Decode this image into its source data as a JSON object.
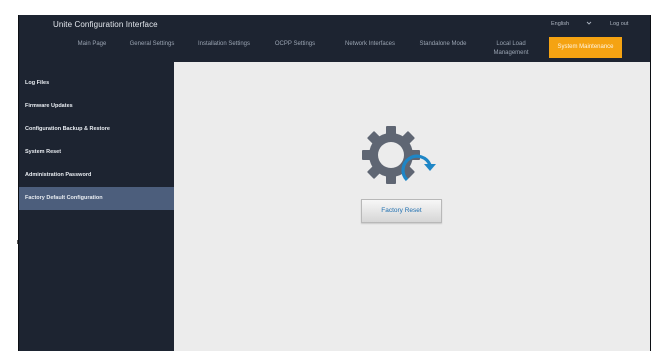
{
  "header": {
    "title": "Unite Configuration Interface",
    "language": "English",
    "logout": "Log out"
  },
  "nav": {
    "items": [
      {
        "label": "Main Page"
      },
      {
        "label": "General Settings"
      },
      {
        "label": "Installation Settings"
      },
      {
        "label": "OCPP Settings"
      },
      {
        "label": "Network Interfaces"
      },
      {
        "label": "Standalone Mode"
      },
      {
        "label": "Local Load Management"
      },
      {
        "label": "System Maintenance",
        "active": true
      }
    ]
  },
  "sidebar": {
    "items": [
      {
        "label": "Log Files"
      },
      {
        "label": "Firmware Updates"
      },
      {
        "label": "Configuration Backup & Restore"
      },
      {
        "label": "System Reset"
      },
      {
        "label": "Administration Password"
      },
      {
        "label": "Factory Default Configuration",
        "active": true
      }
    ]
  },
  "main": {
    "reset_button": "Factory Reset",
    "icon": "gear-reset-icon"
  },
  "colors": {
    "background": "#1d2431",
    "accent": "#f5a312",
    "active_sidebar": "#4c5e7c",
    "content_bg": "#ececec",
    "button_text": "#1f6fb0",
    "arrow": "#1e86c6"
  }
}
